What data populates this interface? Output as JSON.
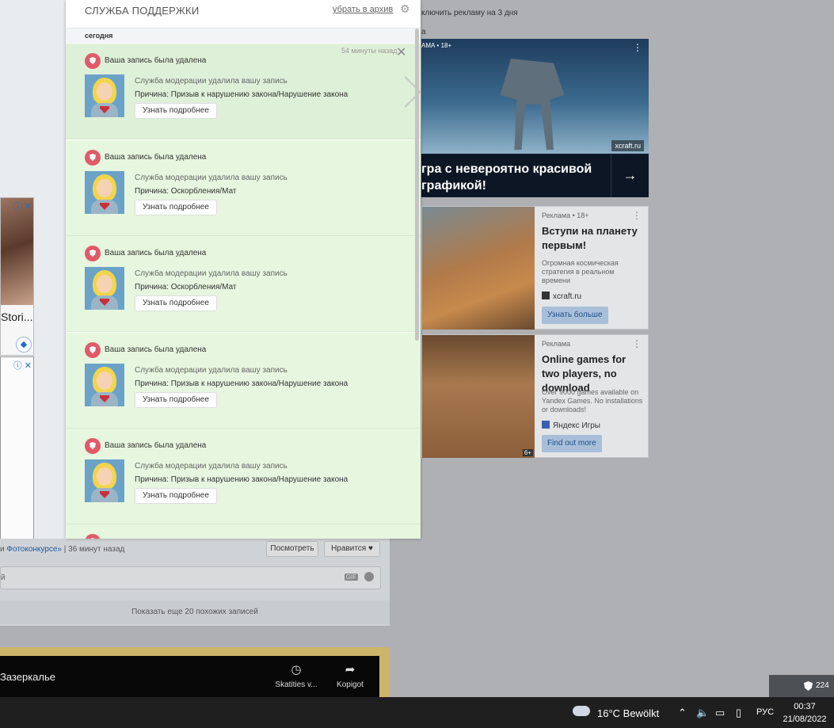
{
  "background": {
    "left_ad": {
      "caption": "Stori...",
      "info": "ⓘ ✕",
      "info2": "ⓘ ✕"
    },
    "feed": {
      "caption_link": "Фотоконкурсе»",
      "caption_prefix": "и ",
      "caption_time": " | 36 минут назад",
      "view_button": "Посмотреть",
      "like_button": "Нравится ♥",
      "comment_prefix": "й",
      "gif_label": "GIF",
      "show_more": "Показать еще 20 похожих записей"
    },
    "video": {
      "title": "Зазеркалье",
      "action1_label": "Skatities v...",
      "action2_label": "Kopigot"
    }
  },
  "right_ads": {
    "top_text": "ключить рекламу на 3 дня",
    "top_text2": "a",
    "big": {
      "label": "АМА • 18+",
      "source": "xcraft.ru",
      "cta_text": "гра с невероятно красивой графикой!",
      "arrow": "→"
    },
    "card1": {
      "label": "Реклама • 18+",
      "title": "Вступи на планету первым!",
      "desc": "Огромная космическая стратегия в реальном времени",
      "source": "xcraft.ru",
      "cta": "Узнать больше"
    },
    "card2": {
      "label": "Реклама",
      "title": "Online games for two players, no download",
      "desc": "Over 9000 games available on Yandex Games. No installations or downloads!",
      "source": "Яндекс Игры",
      "cta": "Find out more",
      "age": "6+"
    }
  },
  "panel": {
    "title": "СЛУЖБА ПОДДЕРЖКИ",
    "archive_link": "убрать в архив",
    "date_group": "сегодня",
    "notifications": [
      {
        "time": "54 минуты назад",
        "head": "Ваша запись была удалена",
        "line1": "Служба модерации удалила вашу запись",
        "line2": "Причина: Призыв к нарушению закона/Нарушение закона",
        "button": "Узнать подробнее"
      },
      {
        "head": "Ваша запись была удалена",
        "line1": "Служба модерации удалила вашу запись",
        "line2": "Причина: Оскорбления/Мат",
        "button": "Узнать подробнее"
      },
      {
        "head": "Ваша запись была удалена",
        "line1": "Служба модерации удалила вашу запись",
        "line2": "Причина: Оскорбления/Мат",
        "button": "Узнать подробнее"
      },
      {
        "head": "Ваша запись была удалена",
        "line1": "Служба модерации удалила вашу запись",
        "line2": "Причина: Призыв к нарушению закона/Нарушение закона",
        "button": "Узнать подробнее"
      },
      {
        "head": "Ваша запись была удалена",
        "line1": "Служба модерации удалила вашу запись",
        "line2": "Причина: Призыв к нарушению закона/Нарушение закона",
        "button": "Узнать подробнее"
      }
    ]
  },
  "taskbar": {
    "tray_badge": "224",
    "weather": "16°C  Bewölkt",
    "language": "РУС",
    "time": "00:37",
    "date": "21/08/2022"
  }
}
